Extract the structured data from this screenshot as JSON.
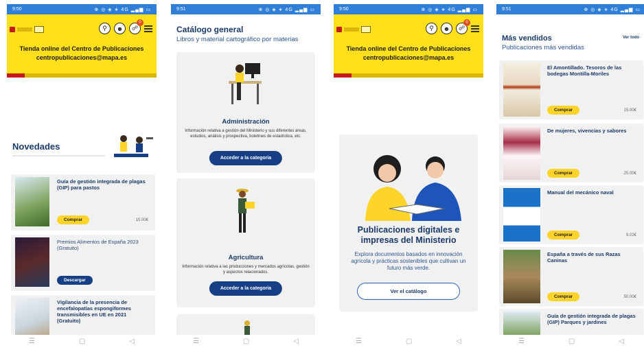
{
  "screen1": {
    "time": "9:50",
    "status_icons": "⊕ ◎ ◈ ∗ 4G ▂▄▆ ▭",
    "header_title": "Tienda online del Centro de Publicaciones",
    "header_email": "centropublicaciones@mapa.es",
    "cart_count": "0",
    "section_title": "Novedades",
    "cards": [
      {
        "title": "Guía de gestión integrada de plagas (GIP) para pastos",
        "button": "Comprar",
        "price": "15.00€"
      },
      {
        "title": "Premios Alimentos de España 2023 (Gratuito)",
        "button": "Descargar"
      },
      {
        "title": "Vigilancia de la presencia de encefalopatías espongiformes transmisibles en UE en 2021 (Gratuito)"
      }
    ]
  },
  "screen2": {
    "time": "9:51",
    "status_icons": "⊕ ◎ ◈ ∗ 4G ▂▄▆ ▭",
    "title": "Catálogo general",
    "subtitle": "Libros y material cartográfico por materias",
    "categories": [
      {
        "name": "Administración",
        "desc": "Información relativa a gestión del Ministerio y sus diferentes áreas, estudios, análisis y prospectiva, boletines de estadística, etc.",
        "button": "Acceder a la categoria"
      },
      {
        "name": "Agricultura",
        "desc": "Información relativa a las producciones y mercados agrícolas, gestión y aspectos relacionados.",
        "button": "Acceder a la categoria"
      }
    ]
  },
  "screen3": {
    "time": "9:50",
    "status_icons": "⊕ ◎ ◈ ∗ 4G ▂▄▆ ▭",
    "header_title": "Tienda online del Centro de Publicaciones",
    "header_email": "centropublicaciones@mapa.es",
    "cart_count": "0",
    "hero_title": "Publicaciones digitales e impresas del Ministerio",
    "hero_text": "Explora documentos basados en innovación agrícola y prácticas sostenibles que cultivan un futuro más verde.",
    "hero_button": "Ver el catálogo"
  },
  "screen4": {
    "time": "9:51",
    "status_icons": "⊕ ◎ ◈ ∗ 4G ▂▄▆ ▭",
    "title": "Más vendidos",
    "subtitle": "Publicaciones más vendidas",
    "see_all": "Ver todo",
    "items": [
      {
        "title": "El Amontillado. Tesoros de las bodegas Montilla-Moriles",
        "button": "Comprar",
        "price": "15.00€"
      },
      {
        "title": "De mujeres, vivencias y sabores",
        "button": "Comprar",
        "price": "25.00€"
      },
      {
        "title": "Manual del mecánico naval",
        "button": "Comprar",
        "price": "9.02€"
      },
      {
        "title": "España a través de sus Razas Caninas",
        "button": "Comprar",
        "price": "50.00€"
      },
      {
        "title": "Guía de gestión integrada de plagas (GIP) Parques y jardines"
      }
    ]
  },
  "nav": {
    "recent": "☰",
    "home": "▢",
    "back": "◁"
  }
}
